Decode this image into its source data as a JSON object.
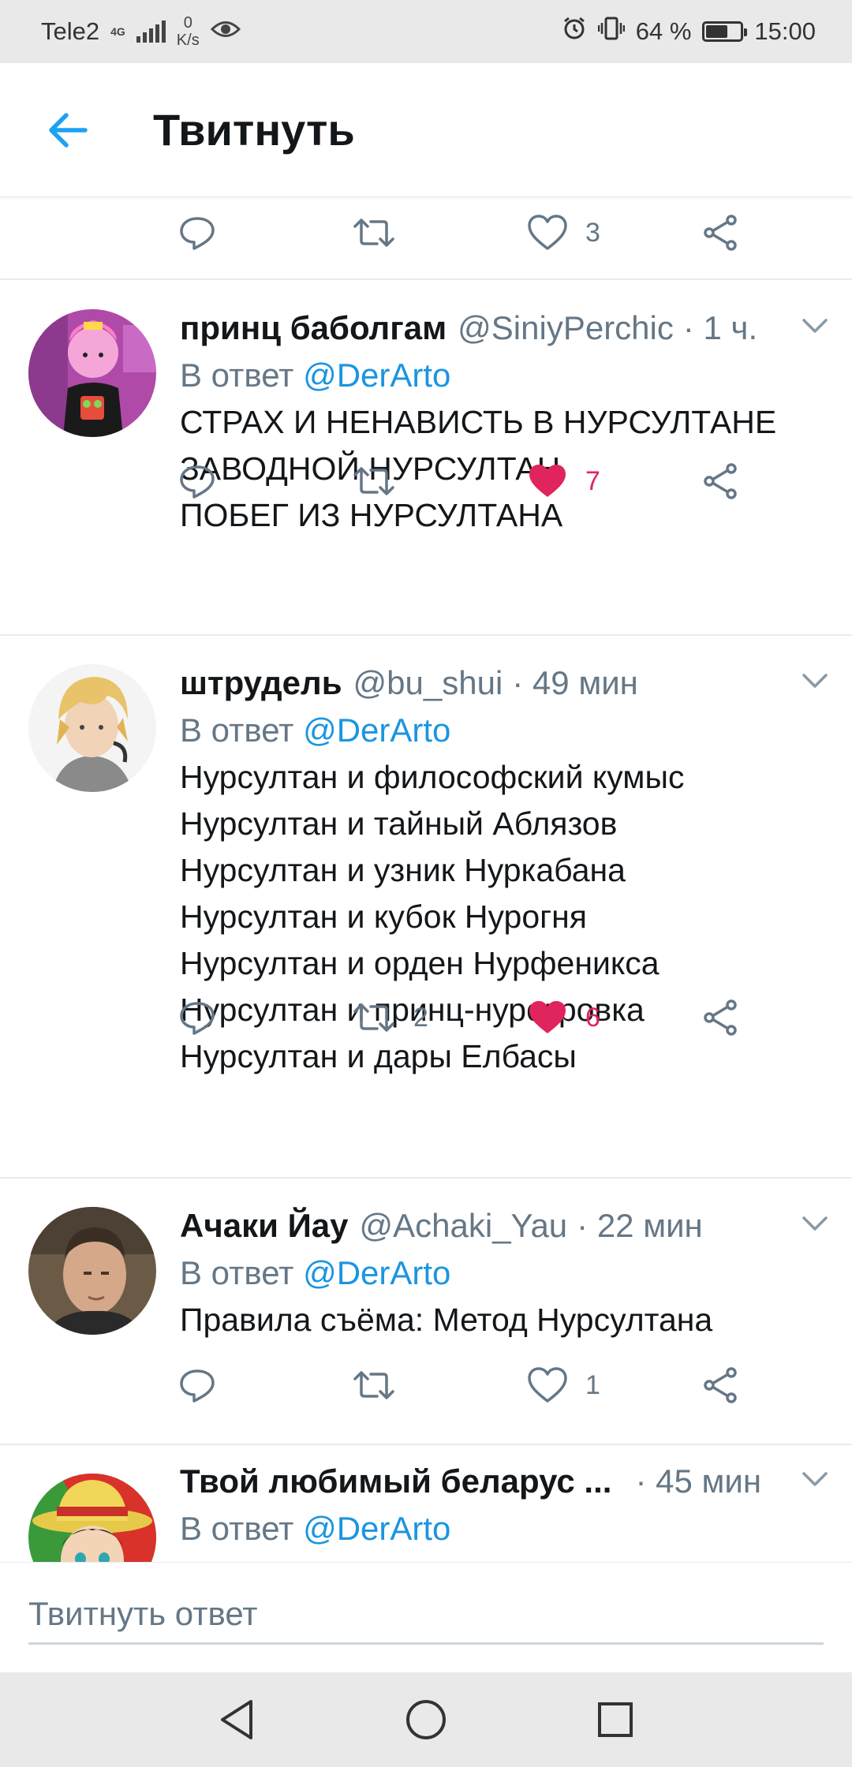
{
  "status_bar": {
    "carrier": "Tele2",
    "network": "4G",
    "speed_value": "0",
    "speed_unit": "K/s",
    "battery": "64 %",
    "time": "15:00"
  },
  "header": {
    "title": "Твитнуть"
  },
  "top_actions": {
    "like_count": "3"
  },
  "tweets": [
    {
      "name": "принц баболгам",
      "handle": "@SiniyPerchic",
      "time": "· 1 ч.",
      "reply_prefix": "В ответ",
      "reply_mention": "@DerArto",
      "lines": [
        "СТРАХ И НЕНАВИСТЬ В НУРСУЛТАНЕ",
        "ЗАВОДНОЙ НУРСУЛТАН",
        "ПОБЕГ ИЗ НУРСУЛТАНА"
      ],
      "retweets": "",
      "likes": "7",
      "liked": true
    },
    {
      "name": "штрудель",
      "handle": "@bu_shui",
      "time": "· 49 мин",
      "reply_prefix": "В ответ",
      "reply_mention": "@DerArto",
      "lines": [
        "Нурсултан и философский кумыс",
        "Нурсултан и тайный Аблязов",
        "Нурсултан и узник Нуркабана",
        "Нурсултан и кубок Нурогня",
        "Нурсултан и орден Нурфеникса",
        "Нурсултан и принц-нурокровка",
        "Нурсултан и дары Елбасы"
      ],
      "retweets": "2",
      "likes": "6",
      "liked": true
    },
    {
      "name": "Ачаки Йау",
      "handle": "@Achaki_Yau",
      "time": "· 22 мин",
      "reply_prefix": "В ответ",
      "reply_mention": "@DerArto",
      "lines": [
        "Правила съёма: Метод Нурсултана"
      ],
      "retweets": "",
      "likes": "1",
      "liked": false
    },
    {
      "name": "Твой любимый беларус ...",
      "handle": "",
      "time": "· 45 мин",
      "reply_prefix": "В ответ",
      "reply_mention": "@DerArto",
      "lines": []
    }
  ],
  "reply_bar": {
    "placeholder": "Твитнуть ответ"
  },
  "colors": {
    "accent": "#1da1f2",
    "like": "#e0245e",
    "muted": "#657786"
  },
  "icons": [
    "back-arrow-icon",
    "reply-icon",
    "retweet-icon",
    "heart-icon",
    "share-icon",
    "chevron-down-icon",
    "nav-back-icon",
    "nav-home-icon",
    "nav-recents-icon"
  ]
}
